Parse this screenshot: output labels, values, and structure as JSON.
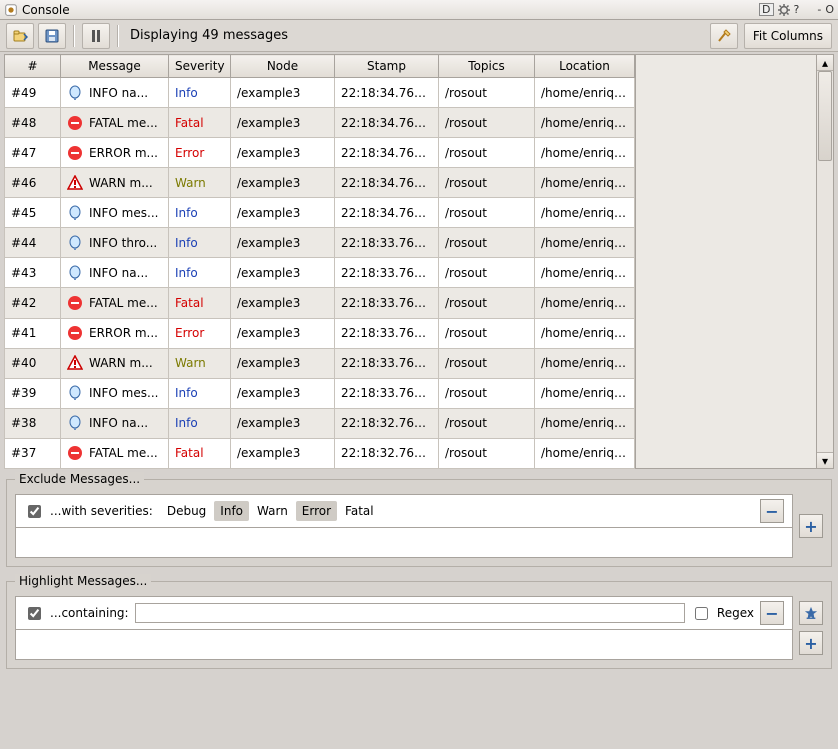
{
  "window": {
    "title": "Console",
    "sys": {
      "dock": "D",
      "gear": "⚙",
      "help": "?",
      "min": "-",
      "close": "O"
    }
  },
  "toolbar": {
    "status": "Displaying 49 messages",
    "fit_columns": "Fit Columns"
  },
  "columns": {
    "num": "#",
    "message": "Message",
    "severity": "Severity",
    "node": "Node",
    "stamp": "Stamp",
    "topics": "Topics",
    "location": "Location"
  },
  "rows": [
    {
      "num": "#49",
      "icon": "info",
      "message": "INFO na...",
      "severity": "Info",
      "node": "/example3",
      "stamp": "22:18:34.763...",
      "topics": "/rosout",
      "location": "/home/enriqu..."
    },
    {
      "num": "#48",
      "icon": "fatal",
      "message": "FATAL me...",
      "severity": "Fatal",
      "node": "/example3",
      "stamp": "22:18:34.763...",
      "topics": "/rosout",
      "location": "/home/enriqu..."
    },
    {
      "num": "#47",
      "icon": "error",
      "message": "ERROR m...",
      "severity": "Error",
      "node": "/example3",
      "stamp": "22:18:34.763...",
      "topics": "/rosout",
      "location": "/home/enriqu..."
    },
    {
      "num": "#46",
      "icon": "warn",
      "message": "WARN m...",
      "severity": "Warn",
      "node": "/example3",
      "stamp": "22:18:34.762...",
      "topics": "/rosout",
      "location": "/home/enriqu..."
    },
    {
      "num": "#45",
      "icon": "info",
      "message": "INFO mes...",
      "severity": "Info",
      "node": "/example3",
      "stamp": "22:18:34.762...",
      "topics": "/rosout",
      "location": "/home/enriqu..."
    },
    {
      "num": "#44",
      "icon": "info",
      "message": "INFO thro...",
      "severity": "Info",
      "node": "/example3",
      "stamp": "22:18:33.763...",
      "topics": "/rosout",
      "location": "/home/enriqu..."
    },
    {
      "num": "#43",
      "icon": "info",
      "message": "INFO na...",
      "severity": "Info",
      "node": "/example3",
      "stamp": "22:18:33.763...",
      "topics": "/rosout",
      "location": "/home/enriqu..."
    },
    {
      "num": "#42",
      "icon": "fatal",
      "message": "FATAL me...",
      "severity": "Fatal",
      "node": "/example3",
      "stamp": "22:18:33.763...",
      "topics": "/rosout",
      "location": "/home/enriqu..."
    },
    {
      "num": "#41",
      "icon": "error",
      "message": "ERROR m...",
      "severity": "Error",
      "node": "/example3",
      "stamp": "22:18:33.763...",
      "topics": "/rosout",
      "location": "/home/enriqu..."
    },
    {
      "num": "#40",
      "icon": "warn",
      "message": "WARN m...",
      "severity": "Warn",
      "node": "/example3",
      "stamp": "22:18:33.762...",
      "topics": "/rosout",
      "location": "/home/enriqu..."
    },
    {
      "num": "#39",
      "icon": "info",
      "message": "INFO mes...",
      "severity": "Info",
      "node": "/example3",
      "stamp": "22:18:33.762...",
      "topics": "/rosout",
      "location": "/home/enriqu..."
    },
    {
      "num": "#38",
      "icon": "info",
      "message": "INFO na...",
      "severity": "Info",
      "node": "/example3",
      "stamp": "22:18:32.763...",
      "topics": "/rosout",
      "location": "/home/enriqu..."
    },
    {
      "num": "#37",
      "icon": "fatal",
      "message": "FATAL me...",
      "severity": "Fatal",
      "node": "/example3",
      "stamp": "22:18:32.763...",
      "topics": "/rosout",
      "location": "/home/enriqu..."
    }
  ],
  "exclude": {
    "legend": "Exclude Messages...",
    "with_severities": "...with severities:",
    "severities": [
      "Debug",
      "Info",
      "Warn",
      "Error",
      "Fatal"
    ],
    "selected": [
      "Info",
      "Error"
    ]
  },
  "highlight": {
    "legend": "Highlight Messages...",
    "containing": "...containing:",
    "regex": "Regex",
    "value": ""
  },
  "glyphs": {
    "minus": "−",
    "plus": "+",
    "clear": "✦"
  }
}
